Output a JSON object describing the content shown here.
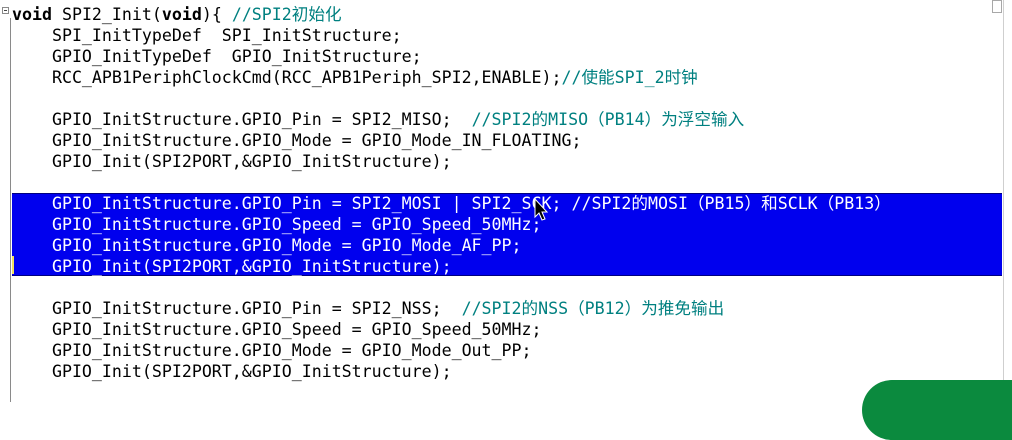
{
  "editor": {
    "lines": [
      {
        "text": "",
        "kw": "void",
        "rest": " SPI2_Init(",
        "kw2": "void",
        "rest2": "){ ",
        "comment": "//SPI2初始化"
      },
      {
        "text": "    SPI_InitTypeDef  SPI_InitStructure;",
        "comment": ""
      },
      {
        "text": "    GPIO_InitTypeDef  GPIO_InitStructure;",
        "comment": ""
      },
      {
        "text": "    RCC_APB1PeriphClockCmd(RCC_APB1Periph_SPI2,ENABLE);",
        "comment": "//使能SPI_2时钟"
      },
      {
        "text": "",
        "comment": ""
      },
      {
        "text": "    GPIO_InitStructure.GPIO_Pin = SPI2_MISO;  ",
        "comment": "//SPI2的MISO（PB14）为浮空输入"
      },
      {
        "text": "    GPIO_InitStructure.GPIO_Mode = GPIO_Mode_IN_FLOATING;",
        "comment": ""
      },
      {
        "text": "    GPIO_Init(SPI2PORT,&GPIO_InitStructure);",
        "comment": ""
      },
      {
        "text": "",
        "comment": ""
      },
      {
        "text": "    GPIO_InitStructure.GPIO_Pin = SPI2_MOSI | SPI2_SCK; ",
        "comment": "//SPI2的MOSI（PB15）和SCLK（PB13）"
      },
      {
        "text": "    GPIO_InitStructure.GPIO_Speed = GPIO_Speed_50MHz;",
        "comment": ""
      },
      {
        "text": "    GPIO_InitStructure.GPIO_Mode = GPIO_Mode_AF_PP;",
        "comment": ""
      },
      {
        "text": "    GPIO_Init(SPI2PORT,&GPIO_InitStructure);",
        "comment": ""
      },
      {
        "text": "",
        "comment": ""
      },
      {
        "text": "    GPIO_InitStructure.GPIO_Pin = SPI2_NSS;  ",
        "comment": "//SPI2的NSS（PB12）为推免输出"
      },
      {
        "text": "    GPIO_InitStructure.GPIO_Speed = GPIO_Speed_50MHz;",
        "comment": ""
      },
      {
        "text": "    GPIO_InitStructure.GPIO_Mode = GPIO_Mode_Out_PP;",
        "comment": ""
      },
      {
        "text": "    GPIO_Init(SPI2PORT,&GPIO_InitStructure);",
        "comment": ""
      }
    ]
  },
  "colors": {
    "selection": "#0000ee",
    "comment": "#008080",
    "keyword": "#000000",
    "background": "#ffffff"
  },
  "icons": {
    "cursor": "text-cursor-icon",
    "fold": "fold-collapse-icon"
  }
}
